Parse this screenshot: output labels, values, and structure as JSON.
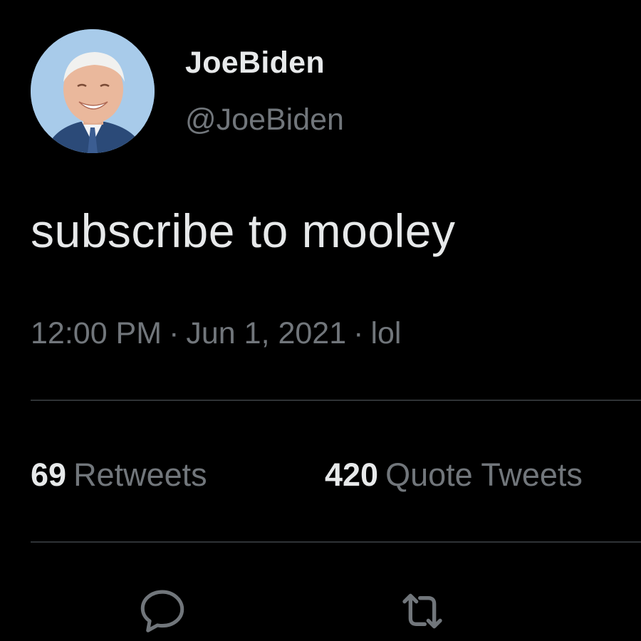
{
  "tweet": {
    "author": {
      "display_name": "JoeBiden",
      "handle": "@JoeBiden"
    },
    "text": "subscribe to mooley",
    "meta": {
      "time": "12:00 PM",
      "date": "Jun 1, 2021",
      "source": "lol",
      "separator": "·"
    },
    "stats": {
      "retweets": {
        "count": "69",
        "label": "Retweets"
      },
      "quote_tweets": {
        "count": "420",
        "label": "Quote Tweets"
      }
    },
    "actions": {
      "reply_icon": "reply-bubble-icon",
      "retweet_icon": "retweet-arrows-icon"
    }
  },
  "colors": {
    "background": "#000000",
    "primary_text": "#e7e9ea",
    "secondary_text": "#71767b",
    "divider": "#2f3336"
  }
}
